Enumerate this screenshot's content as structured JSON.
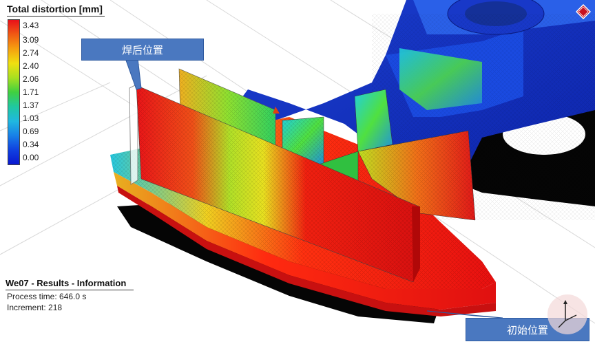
{
  "legend": {
    "title": "Total distortion [mm]",
    "ticks": [
      "3.43",
      "3.09",
      "2.74",
      "2.40",
      "2.06",
      "1.71",
      "1.37",
      "1.03",
      "0.69",
      "0.34",
      "0.00"
    ]
  },
  "callouts": {
    "after_weld": "焊后位置",
    "initial": "初始位置"
  },
  "info": {
    "title": "We07 - Results - Information",
    "process_time": "Process time: 646.0 s",
    "increment": "Increment: 218"
  },
  "icons": {
    "logo": "sw-logo-icon",
    "triad": "axis-triad-icon"
  },
  "colors": {
    "callout": "#4a78c0",
    "max_distortion": "#e8101a",
    "min_distortion": "#0a18d0"
  }
}
